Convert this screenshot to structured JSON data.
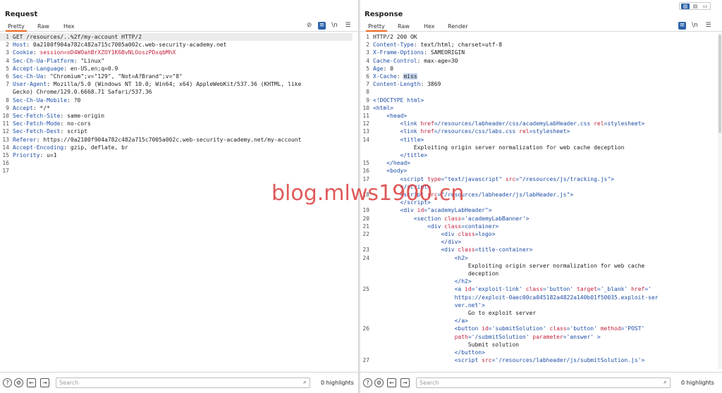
{
  "request": {
    "title": "Request",
    "tabs": [
      "Pretty",
      "Raw",
      "Hex"
    ],
    "active_tab": "Pretty",
    "toolbar_icons": [
      "eye-slash-icon",
      "wrap-icon",
      "newline-icon",
      "menu-icon"
    ],
    "newline_label": "\\n",
    "lines": [
      {
        "n": "1",
        "k": "",
        "v": "GET /resources/..%2f/my-account HTTP/2"
      },
      {
        "n": "2",
        "k": "Host",
        "v": ": 0a2100f904a782c482a715c7005a002c.web-security-academy.net"
      },
      {
        "n": "3",
        "k": "Cookie",
        "v": ": ",
        "ck": "session",
        "cv": "=oD4WOahBrXZOY1K6BvNLOoszPDxqbMhX"
      },
      {
        "n": "4",
        "k": "Sec-Ch-Ua-Platform",
        "v": ": \"Linux\""
      },
      {
        "n": "5",
        "k": "Accept-Language",
        "v": ": en-US,en;q=0.9"
      },
      {
        "n": "6",
        "k": "Sec-Ch-Ua",
        "v": ": \"Chromium\";v=\"129\", \"Not=A?Brand\";v=\"8\""
      },
      {
        "n": "7",
        "k": "User-Agent",
        "v": ": Mozilla/5.0 (Windows NT 10.0; Win64; x64) AppleWebKit/537.36 (KHTML, like"
      },
      {
        "n": "",
        "k": "",
        "v": "Gecko) Chrome/129.0.6668.71 Safari/537.36"
      },
      {
        "n": "8",
        "k": "Sec-Ch-Ua-Mobile",
        "v": ": ?0"
      },
      {
        "n": "9",
        "k": "Accept",
        "v": ": */*"
      },
      {
        "n": "10",
        "k": "Sec-Fetch-Site",
        "v": ": same-origin"
      },
      {
        "n": "11",
        "k": "Sec-Fetch-Mode",
        "v": ": no-cors"
      },
      {
        "n": "12",
        "k": "Sec-Fetch-Dest",
        "v": ": script"
      },
      {
        "n": "13",
        "k": "Referer",
        "v": ": https://0a2100f904a782c482a715c7005a002c.web-security-academy.net/my-account"
      },
      {
        "n": "14",
        "k": "Accept-Encoding",
        "v": ": gzip, deflate, br"
      },
      {
        "n": "15",
        "k": "Priority",
        "v": ": u=1"
      },
      {
        "n": "16",
        "k": "",
        "v": ""
      },
      {
        "n": "17",
        "k": "",
        "v": ""
      }
    ],
    "search_placeholder": "Search",
    "highlights": "0 highlights"
  },
  "response": {
    "title": "Response",
    "tabs": [
      "Pretty",
      "Raw",
      "Hex",
      "Render"
    ],
    "active_tab": "Pretty",
    "toolbar_icons": [
      "wrap-icon",
      "newline-icon",
      "menu-icon"
    ],
    "newline_label": "\\n",
    "headers": [
      {
        "n": "1",
        "k": "",
        "v": "HTTP/2 200 OK"
      },
      {
        "n": "2",
        "k": "Content-Type",
        "v": ": text/html; charset=utf-8"
      },
      {
        "n": "3",
        "k": "X-Frame-Options",
        "v": ": SAMEORIGIN"
      },
      {
        "n": "4",
        "k": "Cache-Control",
        "v": ": max-age=30"
      },
      {
        "n": "5",
        "k": "Age",
        "v": ": 0"
      },
      {
        "n": "6",
        "k": "X-Cache",
        "v": ": ",
        "sel": "miss"
      },
      {
        "n": "7",
        "k": "Content-Length",
        "v": ": 3869"
      },
      {
        "n": "8",
        "k": "",
        "v": ""
      }
    ],
    "html_lines": [
      {
        "n": "9",
        "html": "<span class=\"tag\">&lt;!DOCTYPE html&gt;</span>"
      },
      {
        "n": "10",
        "html": "<span class=\"tag\">&lt;html&gt;</span>"
      },
      {
        "n": "11",
        "html": "    <span class=\"tag\">&lt;head&gt;</span>"
      },
      {
        "n": "12",
        "html": "        <span class=\"tag\">&lt;link </span><span class=\"attr\">href</span><span class=\"tag\">=/resources/labheader/css/academyLabHeader.css </span><span class=\"attr\">rel</span><span class=\"tag\">=stylesheet&gt;</span>"
      },
      {
        "n": "13",
        "html": "        <span class=\"tag\">&lt;link </span><span class=\"attr\">href</span><span class=\"tag\">=/resources/css/labs.css </span><span class=\"attr\">rel</span><span class=\"tag\">=stylesheet&gt;</span>"
      },
      {
        "n": "14",
        "html": "        <span class=\"tag\">&lt;title&gt;</span>"
      },
      {
        "n": "",
        "html": "            <span class=\"txt\">Exploiting origin server normalization for web cache deception</span>"
      },
      {
        "n": "",
        "html": "        <span class=\"tag\">&lt;/title&gt;</span>"
      },
      {
        "n": "15",
        "html": "    <span class=\"tag\">&lt;/head&gt;</span>"
      },
      {
        "n": "16",
        "html": "    <span class=\"tag\">&lt;body&gt;</span>"
      },
      {
        "n": "17",
        "html": "        <span class=\"tag\">&lt;script </span><span class=\"attr\">type</span><span class=\"tag\">=\"text/javascript\" </span><span class=\"attr\">src</span><span class=\"tag\">=\"/resources/js/tracking.js\"&gt;</span>"
      },
      {
        "n": "",
        "html": "        <span class=\"tag\">&lt;/script&gt;</span>"
      },
      {
        "n": "18",
        "html": "        <span class=\"tag\">&lt;script </span><span class=\"attr\">src</span><span class=\"tag\">=\"/resources/labheader/js/labHeader.js\"&gt;</span>"
      },
      {
        "n": "",
        "html": "        <span class=\"tag\">&lt;/script&gt;</span>"
      },
      {
        "n": "19",
        "html": "        <span class=\"tag\">&lt;div </span><span class=\"attr\">id</span><span class=\"tag\">=\"academyLabHeader\"&gt;</span>"
      },
      {
        "n": "20",
        "html": "            <span class=\"tag\">&lt;section </span><span class=\"attr\">class</span><span class=\"tag\">='academyLabBanner'&gt;</span>"
      },
      {
        "n": "21",
        "html": "                <span class=\"tag\">&lt;div </span><span class=\"attr\">class</span><span class=\"tag\">=container&gt;</span>"
      },
      {
        "n": "22",
        "html": "                    <span class=\"tag\">&lt;div </span><span class=\"attr\">class</span><span class=\"tag\">=logo&gt;</span>"
      },
      {
        "n": "",
        "html": "                    <span class=\"tag\">&lt;/div&gt;</span>"
      },
      {
        "n": "23",
        "html": "                    <span class=\"tag\">&lt;div </span><span class=\"attr\">class</span><span class=\"tag\">=title-container&gt;</span>"
      },
      {
        "n": "24",
        "html": "                        <span class=\"tag\">&lt;h2&gt;</span>"
      },
      {
        "n": "",
        "html": "                            <span class=\"txt\">Exploiting origin server normalization for web cache</span>"
      },
      {
        "n": "",
        "html": "                            <span class=\"txt\">deception</span>"
      },
      {
        "n": "",
        "html": "                        <span class=\"tag\">&lt;/h2&gt;</span>"
      },
      {
        "n": "25",
        "html": "                        <span class=\"tag\">&lt;a </span><span class=\"attr\">id</span><span class=\"tag\">='exploit-link' </span><span class=\"attr\">class</span><span class=\"tag\">='button' </span><span class=\"attr\">target</span><span class=\"tag\">='_blank' </span><span class=\"attr\">href</span><span class=\"tag\">='</span>"
      },
      {
        "n": "",
        "html": "                        <span class=\"tag\">https://exploit-0aec00ca045182a4822a140b01f50035.exploit-ser</span>"
      },
      {
        "n": "",
        "html": "                        <span class=\"tag\">ver.net'&gt;</span>"
      },
      {
        "n": "",
        "html": "                            <span class=\"txt\">Go to exploit server</span>"
      },
      {
        "n": "",
        "html": "                        <span class=\"tag\">&lt;/a&gt;</span>"
      },
      {
        "n": "26",
        "html": "                        <span class=\"tag\">&lt;button </span><span class=\"attr\">id</span><span class=\"tag\">='submitSolution' </span><span class=\"attr\">class</span><span class=\"tag\">='button' </span><span class=\"attr\">method</span><span class=\"tag\">='POST'</span>"
      },
      {
        "n": "",
        "html": "                        <span class=\"attr\">path</span><span class=\"tag\">='/submitSolution' </span><span class=\"attr\">parameter</span><span class=\"tag\">='answer' &gt;</span>"
      },
      {
        "n": "",
        "html": "                            <span class=\"txt\">Submit solution</span>"
      },
      {
        "n": "",
        "html": "                        <span class=\"tag\">&lt;/button&gt;</span>"
      },
      {
        "n": "27",
        "html": "                        <span class=\"tag\">&lt;script </span><span class=\"attr\">src</span><span class=\"tag\">='/resources/labheader/js/submitSolution.js'&gt;</span>"
      }
    ],
    "search_placeholder": "Search",
    "highlights": "0 highlights"
  },
  "watermark": "blog.mlws1900.cn",
  "colors": {
    "accent": "#e8651b",
    "active_button": "#2b61a9",
    "header_key": "#1d4ea6",
    "cookie": "#c3213b"
  }
}
